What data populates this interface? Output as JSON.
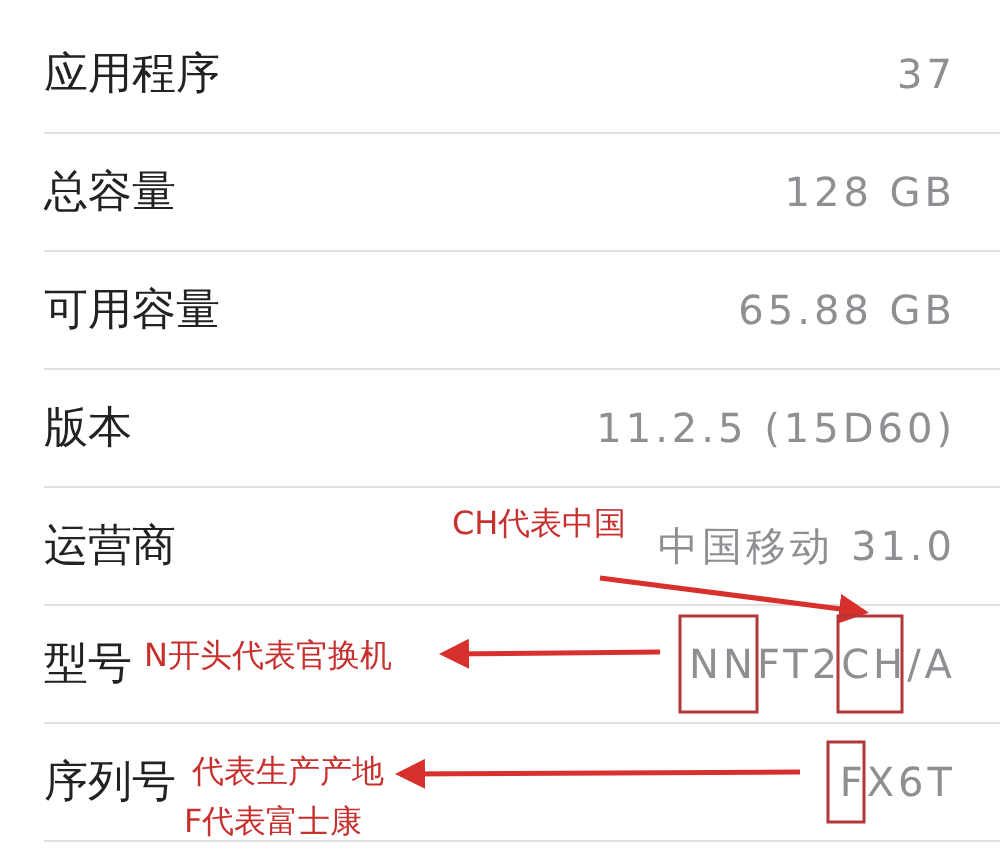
{
  "rows": [
    {
      "label": "应用程序",
      "value": "37"
    },
    {
      "label": "总容量",
      "value": "128 GB"
    },
    {
      "label": "可用容量",
      "value": "65.88 GB"
    },
    {
      "label": "版本",
      "value": "11.2.5 (15D60)"
    },
    {
      "label": "运营商",
      "value": "中国移动 31.0"
    },
    {
      "label": "型号",
      "value": "NNFT2CH/A"
    },
    {
      "label": "序列号",
      "value": "FX6T"
    }
  ],
  "annotations": [
    "CH代表中国",
    "N开头代表官换机",
    "代表生产产地",
    "F代表富士康"
  ]
}
